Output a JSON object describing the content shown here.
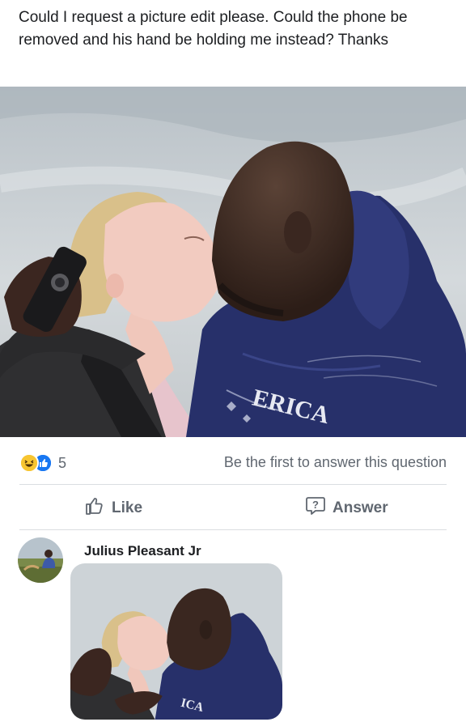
{
  "post": {
    "text": "Could I request a picture edit please. Could the phone be removed and his hand be holding me instead? Thanks"
  },
  "photo": {
    "shirt_text": "ERICA"
  },
  "reactions": {
    "icons": [
      "haha-reaction-icon",
      "like-reaction-icon"
    ],
    "count": "5"
  },
  "answer_prompt": "Be the first to answer this question",
  "actions": {
    "like_label": "Like",
    "answer_label": "Answer"
  },
  "comment": {
    "author": "Julius Pleasant Jr",
    "thumb_shirt_text": "ICA"
  },
  "colors": {
    "text": "#1c1e21",
    "secondary_text": "#606770",
    "like_blue": "#1877f2",
    "haha_yellow": "#f7c531",
    "hoodie_navy": "#27306a"
  }
}
